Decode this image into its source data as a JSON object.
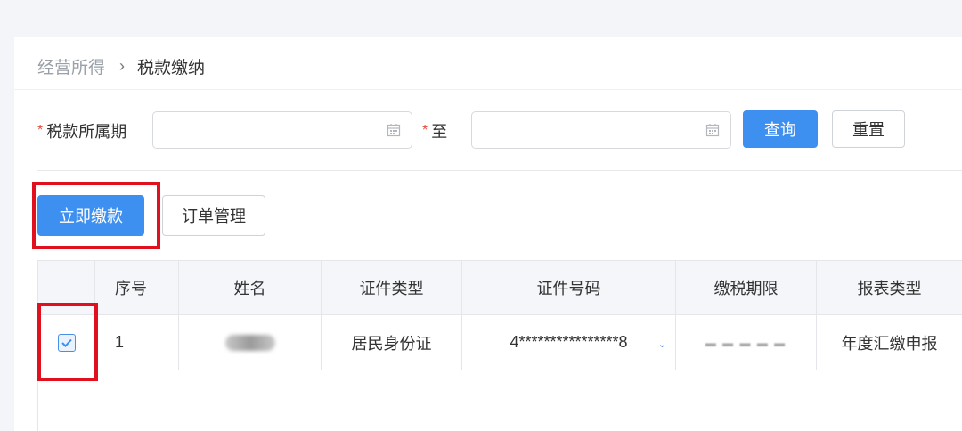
{
  "breadcrumb": {
    "parent": "经营所得",
    "separator": "›",
    "current": "税款缴纳"
  },
  "filter": {
    "period_label": "税款所属期",
    "to_label": "至",
    "required_mark": "*",
    "start_value": "",
    "end_value": "",
    "query_button": "查询",
    "reset_button": "重置"
  },
  "actions": {
    "pay_now": "立即缴款",
    "order_manage": "订单管理"
  },
  "table": {
    "headers": [
      "序号",
      "姓名",
      "证件类型",
      "证件号码",
      "缴税期限",
      "报表类型"
    ],
    "rows": [
      {
        "checked": true,
        "index": "1",
        "id_type": "居民身份证",
        "id_number": "4****************8",
        "report_type": "年度汇缴申报"
      }
    ]
  },
  "colors": {
    "primary": "#3d8ff0",
    "highlight": "#e0101e",
    "required": "#e74c3c"
  }
}
